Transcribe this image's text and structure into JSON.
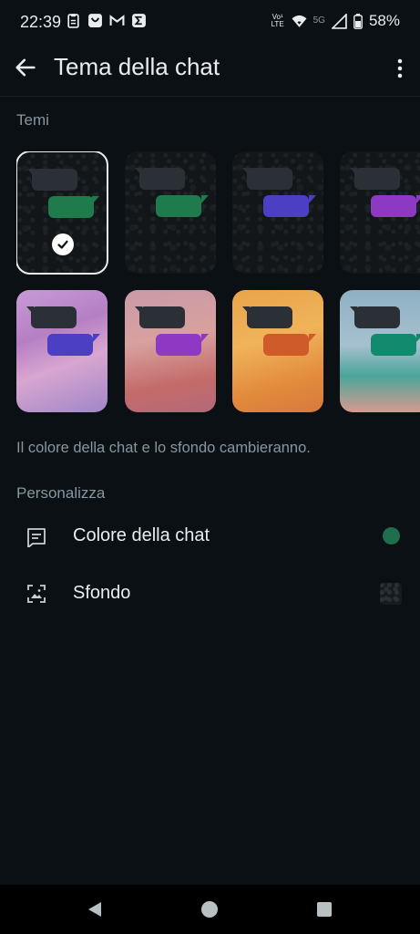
{
  "status_bar": {
    "time": "22:39",
    "battery": "58%",
    "net_top": "Vo¹",
    "net_bottom": "LTE",
    "signal_label": "5G"
  },
  "app_bar": {
    "title": "Tema della chat",
    "back_icon": "arrow-back-icon",
    "more_icon": "more-vert-icon"
  },
  "themes_section": {
    "label": "Temi",
    "row1": [
      {
        "style": "dark",
        "accent": "#1f7a4c",
        "selected": true
      },
      {
        "style": "dark",
        "accent": "#1f7a4c",
        "selected": false
      },
      {
        "style": "dark",
        "accent": "#4b3fc4",
        "selected": false
      },
      {
        "style": "dark",
        "accent": "#8e39c4",
        "selected": false
      }
    ],
    "row2": [
      {
        "style": "image",
        "accent": "#4b3fc4",
        "bg": "linear-gradient(160deg,#c79bd6 0%,#b67fc4 35%,#d8a6d0 60%,#9f86c9 100%)"
      },
      {
        "style": "image",
        "accent": "#8e39c4",
        "bg": "linear-gradient(170deg,#c99aa7 0%,#d8a19e 40%,#c46a6a 75%,#b36a78 100%)"
      },
      {
        "style": "image",
        "accent": "#cf5b2b",
        "bg": "linear-gradient(165deg,#e9a44a 0%,#f0b35a 40%,#e28a3c 75%,#d67a40 100%)"
      },
      {
        "style": "image",
        "accent": "#118a6e",
        "bg": "linear-gradient(180deg,#8fb0c4 0%,#a6c0cf 45%,#4aa59a 70%,#d89a8e 100%)"
      }
    ],
    "hint": "Il colore della chat e lo sfondo cambieranno."
  },
  "customize_section": {
    "label": "Personalizza",
    "items": [
      {
        "label": "Colore della chat",
        "icon": "chat-bubble-lines-icon",
        "swatch": "#1f6e4d"
      },
      {
        "label": "Sfondo",
        "icon": "wallpaper-icon"
      }
    ]
  },
  "colors": {
    "background": "#0b1014",
    "text_primary": "#e9edef",
    "text_secondary": "#8696a0"
  },
  "nav_bar": {
    "icons": [
      "nav-back-icon",
      "nav-home-icon",
      "nav-recents-icon"
    ]
  }
}
